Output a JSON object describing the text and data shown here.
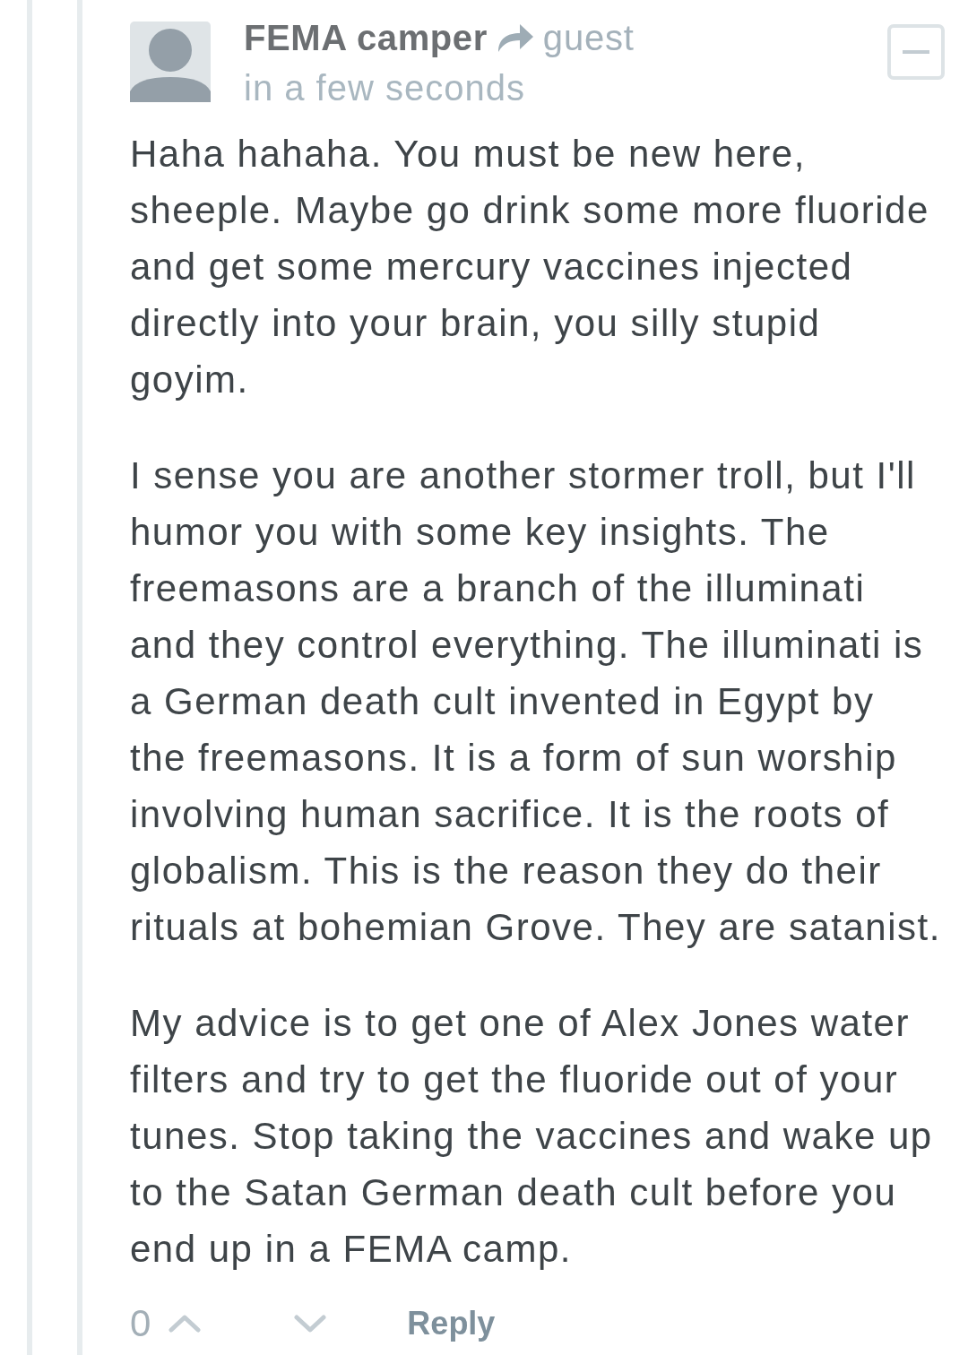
{
  "comment": {
    "author": "FEMA camper",
    "reply_to": "guest",
    "timestamp": "in a few seconds",
    "paragraphs": [
      "Haha hahaha. You must be new here, sheeple. Maybe go drink some more fluoride and get some mercury vaccines injected directly into your brain, you silly stupid goyim.",
      "I sense you are another stormer troll, but I'll humor you with some key insights. The freemasons are a branch of the illuminati and they control everything. The illuminati is a German death cult invented in Egypt by the freemasons. It is a form of sun worship involving human sacrifice. It is the roots of globalism. This is the reason they do their rituals at bohemian Grove. They are satanist.",
      "My advice is to get one of Alex Jones water filters and try to get the fluoride out of your tunes. Stop taking the vaccines and wake up to the Satan German death cult before you end up in a FEMA camp."
    ],
    "votes": {
      "count": "0"
    },
    "actions": [
      {
        "kind": "reply",
        "label": "Reply"
      }
    ]
  }
}
